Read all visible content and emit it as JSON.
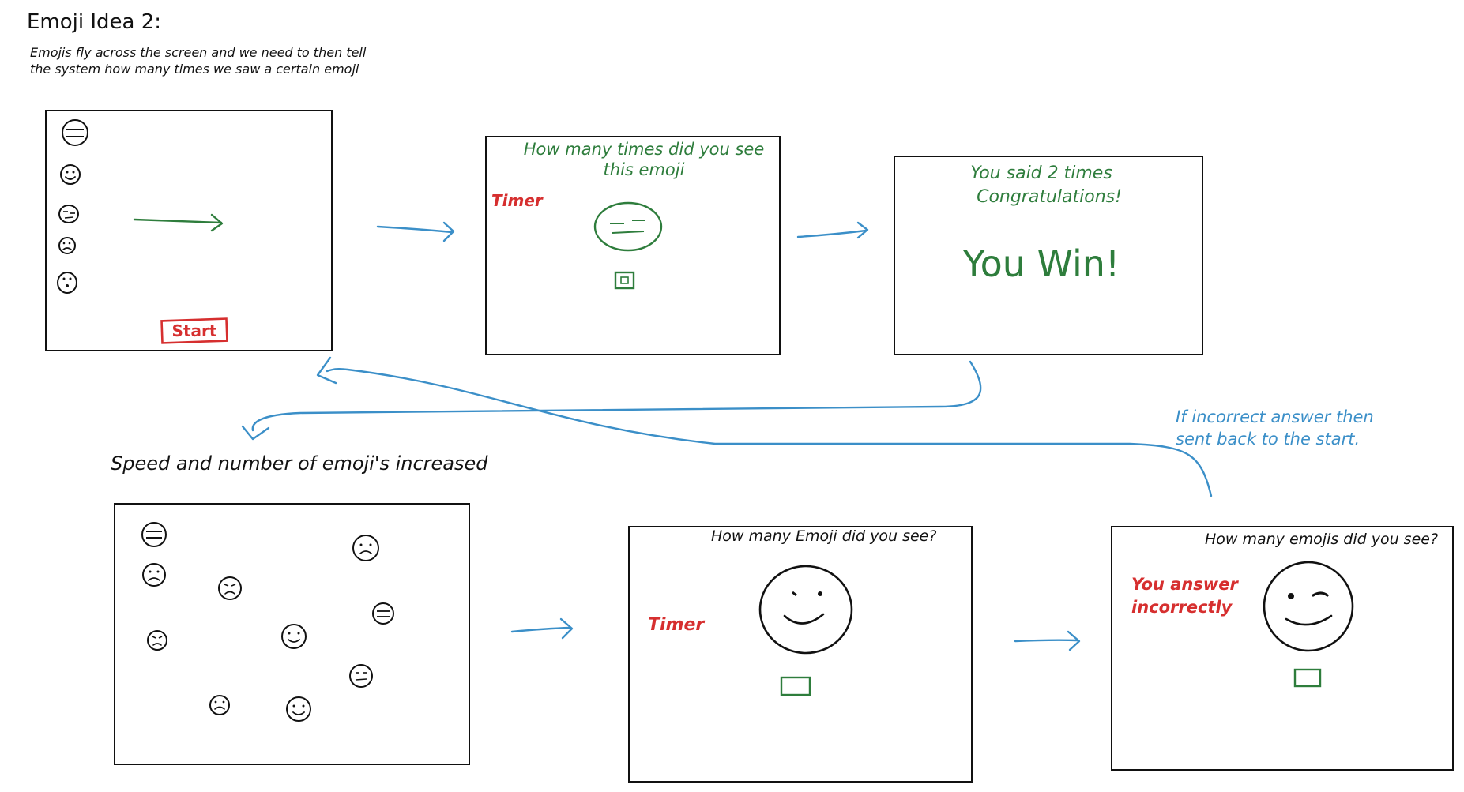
{
  "title": "Emoji Idea 2:",
  "description": "Emojis fly across the screen and we need to then tell the system how many times we saw a certain emoji",
  "note_increase": "Speed and number of emoji's increased",
  "note_incorrect": "If incorrect answer then sent back to the start.",
  "panel1": {
    "start_button": "Start"
  },
  "panel2": {
    "question": "How many times did you see this emoji",
    "timer": "Timer"
  },
  "panel3": {
    "said": "You said 2 times",
    "congrats": "Congratulations!",
    "win": "You Win!"
  },
  "panel5": {
    "question": "How many Emoji did you see?",
    "timer": "Timer"
  },
  "panel6": {
    "question": "How many emojis did you see?",
    "incorrect": "You answer incorrectly"
  },
  "colors": {
    "ink": "#111111",
    "green": "#2e7d3c",
    "red": "#d62f2f",
    "blue": "#3b8fc8"
  }
}
